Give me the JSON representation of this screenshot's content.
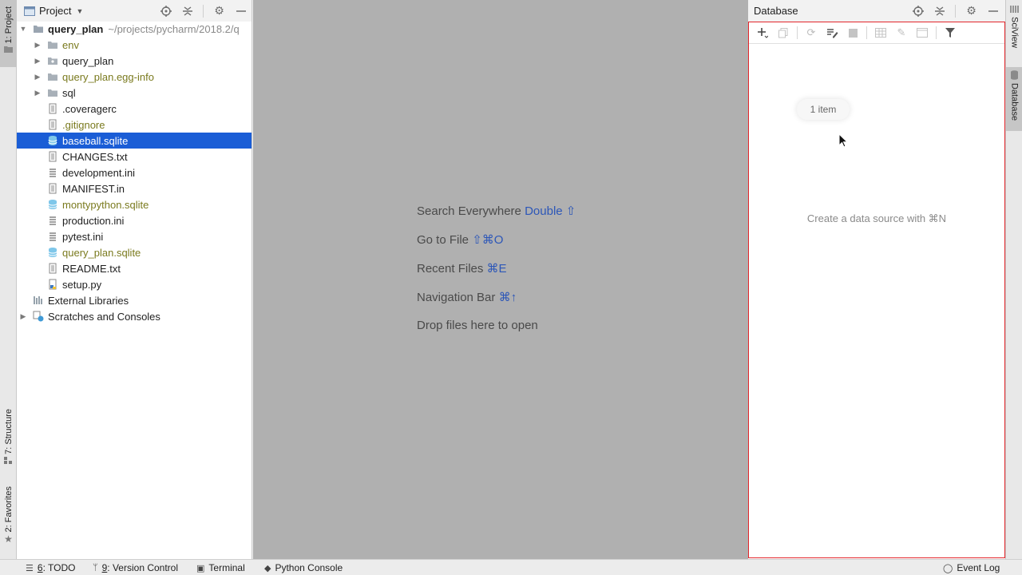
{
  "left_strip": {
    "tabs": [
      {
        "label": "1: Project",
        "icon": "folder-icon"
      },
      {
        "label": "7: Structure",
        "icon": "structure-icon"
      },
      {
        "label": "2: Favorites",
        "icon": "star-icon"
      }
    ]
  },
  "project_panel": {
    "title": "Project",
    "tree": [
      {
        "label": "query_plan",
        "path": "~/projects/pycharm/2018.2/q",
        "depth": 0,
        "expanded": true,
        "icon": "folder-icon",
        "style": "bold"
      },
      {
        "label": "env",
        "depth": 1,
        "expanded": false,
        "icon": "folder-icon",
        "style": "olive"
      },
      {
        "label": "query_plan",
        "depth": 1,
        "expanded": false,
        "icon": "package-folder-icon",
        "style": "normal"
      },
      {
        "label": "query_plan.egg-info",
        "depth": 1,
        "expanded": false,
        "icon": "folder-icon",
        "style": "olive"
      },
      {
        "label": "sql",
        "depth": 1,
        "expanded": false,
        "icon": "folder-icon",
        "style": "normal"
      },
      {
        "label": ".coveragerc",
        "depth": 1,
        "icon": "text-file-icon",
        "style": "normal"
      },
      {
        "label": ".gitignore",
        "depth": 1,
        "icon": "text-file-icon",
        "style": "olive"
      },
      {
        "label": "baseball.sqlite",
        "depth": 1,
        "icon": "database-file-icon",
        "style": "selected"
      },
      {
        "label": "CHANGES.txt",
        "depth": 1,
        "icon": "text-file-icon",
        "style": "normal"
      },
      {
        "label": "development.ini",
        "depth": 1,
        "icon": "config-file-icon",
        "style": "normal"
      },
      {
        "label": "MANIFEST.in",
        "depth": 1,
        "icon": "text-file-icon",
        "style": "normal"
      },
      {
        "label": "montypython.sqlite",
        "depth": 1,
        "icon": "database-file-icon",
        "style": "olive"
      },
      {
        "label": "production.ini",
        "depth": 1,
        "icon": "config-file-icon",
        "style": "normal"
      },
      {
        "label": "pytest.ini",
        "depth": 1,
        "icon": "config-file-icon",
        "style": "normal"
      },
      {
        "label": "query_plan.sqlite",
        "depth": 1,
        "icon": "database-file-icon",
        "style": "olive"
      },
      {
        "label": "README.txt",
        "depth": 1,
        "icon": "text-file-icon",
        "style": "normal"
      },
      {
        "label": "setup.py",
        "depth": 1,
        "icon": "python-file-icon",
        "style": "normal"
      },
      {
        "label": "External Libraries",
        "depth": 0,
        "icon": "library-icon",
        "style": "normal"
      },
      {
        "label": "Scratches and Consoles",
        "depth": 0,
        "expanded": false,
        "icon": "scratches-icon",
        "style": "normal"
      }
    ]
  },
  "editor": {
    "hints": [
      {
        "text": "Search Everywhere",
        "key": "Double ⇧"
      },
      {
        "text": "Go to File",
        "key": "⇧⌘O"
      },
      {
        "text": "Recent Files",
        "key": "⌘E"
      },
      {
        "text": "Navigation Bar",
        "key": "⌘↑"
      },
      {
        "text": "Drop files here to open",
        "key": ""
      }
    ]
  },
  "database_panel": {
    "title": "Database",
    "tooltip": "1 item",
    "empty_message": "Create a data source with ⌘N"
  },
  "right_strip": {
    "tabs": [
      {
        "label": "SciView",
        "icon": "sciview-icon"
      },
      {
        "label": "Database",
        "icon": "database-icon"
      }
    ]
  },
  "status_bar": {
    "todo": {
      "mnemonic": "6",
      "label": ": TODO"
    },
    "vcs": {
      "mnemonic": "9",
      "label": ": Version Control"
    },
    "terminal": "Terminal",
    "python_console": "Python Console",
    "event_log": "Event Log"
  },
  "colors": {
    "selection": "#1a5dd6",
    "olive_text": "#7a7a1e",
    "focus_border": "#e3262b",
    "shortcut_key": "#2d57b8"
  }
}
